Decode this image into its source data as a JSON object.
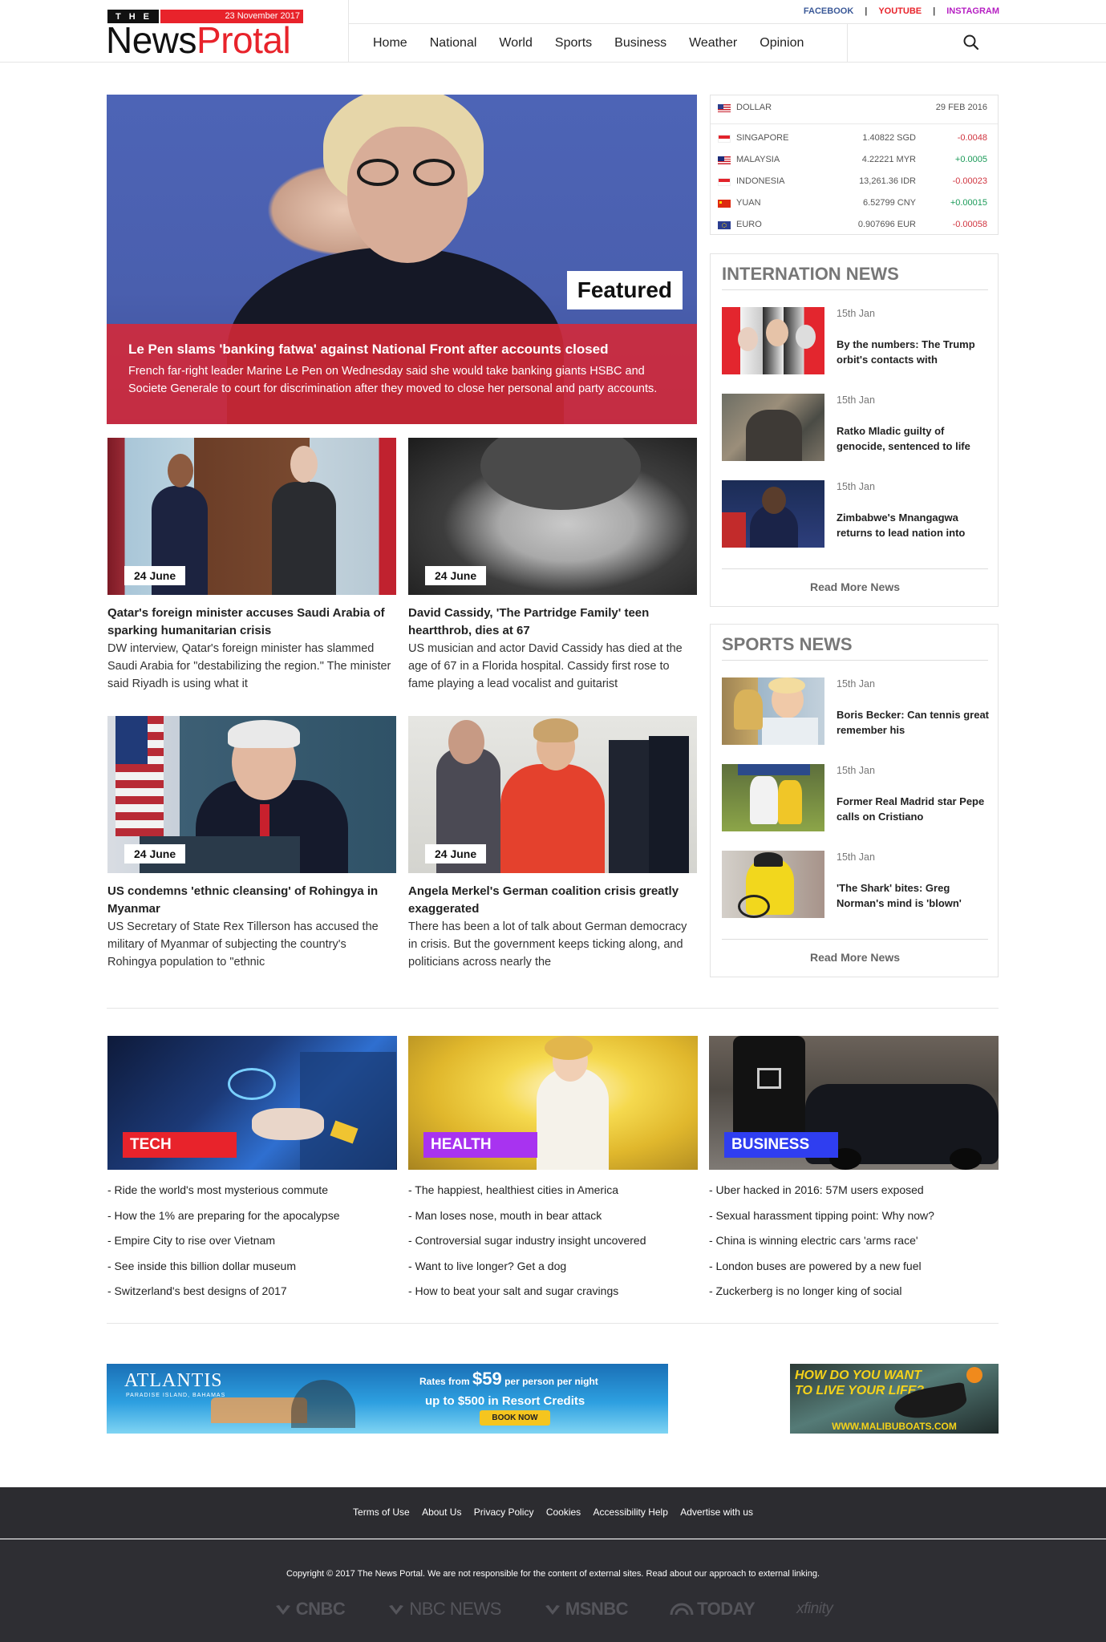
{
  "header": {
    "logo_the": [
      "T",
      "H",
      "E"
    ],
    "logo_date": "23 November 2017",
    "logo_news": "News",
    "logo_portal": "Protal",
    "social": [
      {
        "label": "FACEBOOK",
        "color": "#3b5998"
      },
      {
        "label": "YOUTUBE",
        "color": "#e8232b"
      },
      {
        "label": "INSTAGRAM",
        "color": "#b620c3"
      }
    ],
    "social_sep": "|",
    "nav": [
      "Home",
      "National",
      "World",
      "Sports",
      "Business",
      "Weather",
      "Opinion"
    ]
  },
  "featured": {
    "badge": "Featured",
    "title": "Le Pen slams 'banking fatwa' against National Front after accounts closed",
    "summary": "French far-right leader Marine Le Pen on Wednesday said she would take banking giants HSBC and Societe Generale to court for discrimination after they moved to close her personal and party accounts."
  },
  "stories": [
    {
      "date": "24 June",
      "title": "Qatar's foreign minister accuses Saudi Arabia of sparking humanitarian crisis",
      "summary": "DW interview, Qatar's foreign minister has slammed Saudi Arabia for \"destabilizing the region.\" The minister said Riyadh is using what it"
    },
    {
      "date": "24 June",
      "title": "David Cassidy, 'The Partridge Family' teen heartthrob, dies at 67",
      "summary": "US musician and actor David Cassidy has died at the age of 67 in a Florida hospital. Cassidy first rose to fame playing a lead vocalist and guitarist"
    },
    {
      "date": "24 June",
      "title": "US condemns 'ethnic cleansing' of Rohingya in Myanmar",
      "summary": "US Secretary of State Rex Tillerson has accused the military of Myanmar of subjecting the country's Rohingya population to \"ethnic"
    },
    {
      "date": "24 June",
      "title": "Angela Merkel's German coalition crisis greatly exaggerated",
      "summary": "There has been a lot of talk about German democracy in crisis. But the government keeps ticking along, and politicians across nearly the"
    }
  ],
  "currency": {
    "base": {
      "name": "DOLLAR",
      "date": "29 FEB 2016"
    },
    "rows": [
      {
        "name": "SINGAPORE",
        "value": "1.40822 SGD",
        "change": "-0.0048",
        "dir": "down"
      },
      {
        "name": "MALAYSIA",
        "value": "4.22221 MYR",
        "change": "+0.0005",
        "dir": "up"
      },
      {
        "name": "INDONESIA",
        "value": "13,261.36 IDR",
        "change": "-0.00023",
        "dir": "down"
      },
      {
        "name": "YUAN",
        "value": "6.52799 CNY",
        "change": "+0.00015",
        "dir": "up"
      },
      {
        "name": "EURO",
        "value": "0.907696 EUR",
        "change": "-0.00058",
        "dir": "down"
      }
    ]
  },
  "intl_news": {
    "heading": "INTERNATION NEWS",
    "items": [
      {
        "date": "15th Jan",
        "title": "By the numbers: The Trump orbit's contacts with"
      },
      {
        "date": "15th Jan",
        "title": "Ratko Mladic guilty of genocide, sentenced to life"
      },
      {
        "date": "15th Jan",
        "title": "Zimbabwe's Mnangagwa returns to lead nation into"
      }
    ],
    "more": "Read More News"
  },
  "sports_news": {
    "heading": "SPORTS NEWS",
    "items": [
      {
        "date": "15th Jan",
        "title": "Boris Becker: Can tennis great remember his"
      },
      {
        "date": "15th Jan",
        "title": "Former Real Madrid star Pepe calls on Cristiano"
      },
      {
        "date": "15th Jan",
        "title": "'The Shark' bites: Greg Norman's mind is 'blown'"
      }
    ],
    "more": "Read More News"
  },
  "categories": [
    {
      "label": "TECH",
      "color": "#e8232b",
      "items": [
        "- Ride the world's most mysterious commute",
        "- How the 1% are preparing for the apocalypse",
        "- Empire City to rise over Vietnam",
        "- See inside this billion dollar museum",
        "- Switzerland's best designs of 2017"
      ]
    },
    {
      "label": "HEALTH",
      "color": "#a833f0",
      "items": [
        "- The happiest, healthiest cities in America",
        "- Man loses nose, mouth in bear attack",
        "- Controversial sugar industry insight uncovered",
        "- Want to live longer? Get a dog",
        "- How to beat your salt and sugar cravings"
      ]
    },
    {
      "label": "BUSINESS",
      "color": "#2f3ef0",
      "items": [
        "- Uber hacked in 2016: 57M users exposed",
        "- Sexual harassment tipping point: Why now?",
        "- China is winning electric cars 'arms race'",
        "- London buses are powered by a new fuel",
        "- Zuckerberg is no longer king of social"
      ]
    }
  ],
  "ads": {
    "atlantis_name": "ATLANTIS",
    "atlantis_sub": "PARADISE ISLAND, BAHAMAS",
    "atlantis_rates_pre": "Rates from",
    "atlantis_price": "$59",
    "atlantis_rates_post": "per person per night",
    "atlantis_credit": "up to $500 in Resort Credits",
    "atlantis_cta": "BOOK NOW",
    "malibu_line1": "HOW DO YOU WANT",
    "malibu_line2": "TO LIVE YOUR LIFE?",
    "malibu_url": "WWW.MALIBUBOATS.COM"
  },
  "footer": {
    "links": [
      "Terms of Use",
      "About Us",
      "Privacy Policy",
      "Cookies",
      "Accessibility Help",
      "Advertise with us"
    ],
    "copyright": "Copyright © 2017 The News Portal. We are not responsible for the content of external sites. Read about our approach to external linking.",
    "brands": [
      "CNBC",
      "NBC NEWS",
      "MSNBC",
      "TODAY",
      "xfinity"
    ]
  }
}
